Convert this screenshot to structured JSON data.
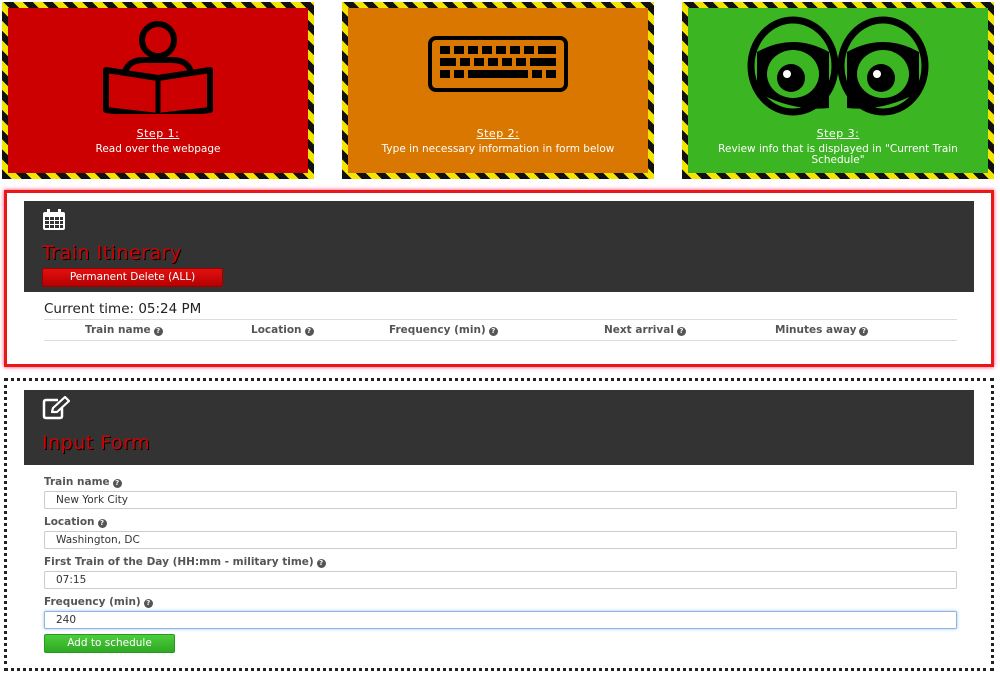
{
  "steps": [
    {
      "title": "Step 1:",
      "text": "Read over the webpage",
      "icon": "reading-person-icon",
      "color": "#cc0000"
    },
    {
      "title": "Step 2:",
      "text": "Type in necessary information in form below",
      "icon": "keyboard-icon",
      "color": "#d97700"
    },
    {
      "title": "Step 3:",
      "text": "Review info that is displayed in \"Current Train Schedule\"",
      "icon": "eyes-icon",
      "color": "#3bb522"
    }
  ],
  "itinerary": {
    "title": "Train Itinerary",
    "icon": "calendar-icon",
    "delete_label": "Permanent Delete (ALL)",
    "current_time": "Current time: 05:24 PM",
    "columns": [
      "Train name",
      "Location",
      "Frequency (min)",
      "Next arrival",
      "Minutes away"
    ],
    "rows": []
  },
  "form": {
    "title": "Input Form",
    "icon": "edit-icon",
    "fields": [
      {
        "label": "Train name",
        "value": "New York City"
      },
      {
        "label": "Location",
        "value": "Washington, DC"
      },
      {
        "label": "First Train of the Day (HH:mm - military time)",
        "value": "07:15"
      },
      {
        "label": "Frequency (min)",
        "value": "240"
      }
    ],
    "submit_label": "Add to schedule"
  },
  "colors": {
    "accent_red": "#d40000",
    "header_bg": "#333333",
    "success_green": "#3bb522"
  }
}
